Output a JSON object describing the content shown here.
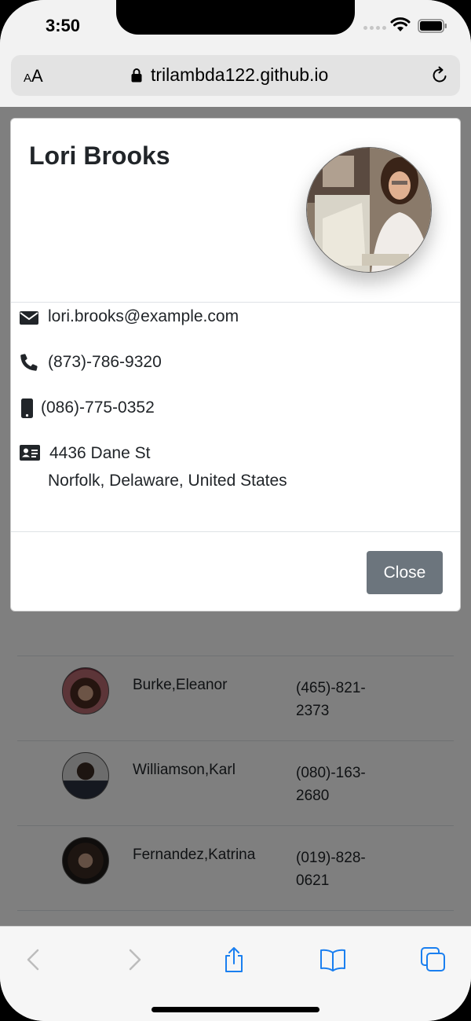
{
  "status_bar": {
    "time": "3:50"
  },
  "browser": {
    "text_size_label_small": "A",
    "text_size_label_large": "A",
    "url": "trilambda122.github.io"
  },
  "modal": {
    "title": "Lori Brooks",
    "email": "lori.brooks@example.com",
    "phone": "(873)-786-9320",
    "cell": "(086)-775-0352",
    "address_street": "4436 Dane St",
    "address_region": "Norfolk, Delaware, United States",
    "close_label": "Close"
  },
  "contacts": [
    {
      "name": "Burke,Eleanor",
      "phone_line1": "(465)-821-",
      "phone_line2": "2373"
    },
    {
      "name": "Williamson,Karl",
      "phone_line1": "(080)-163-",
      "phone_line2": "2680"
    },
    {
      "name": "Fernandez,Katrina",
      "phone_line1": "(019)-828-",
      "phone_line2": "0621"
    }
  ],
  "colors": {
    "button_secondary": "#6c757d",
    "text": "#212529",
    "ios_blue": "#1a7ff0",
    "backdrop": "rgba(0,0,0,0.5)"
  },
  "icons": {
    "email": "envelope-icon",
    "phone": "phone-icon",
    "cell": "mobile-icon",
    "address": "address-card-icon",
    "toolbar": [
      "back-icon",
      "forward-icon",
      "share-icon",
      "bookmarks-icon",
      "tabs-icon"
    ]
  }
}
